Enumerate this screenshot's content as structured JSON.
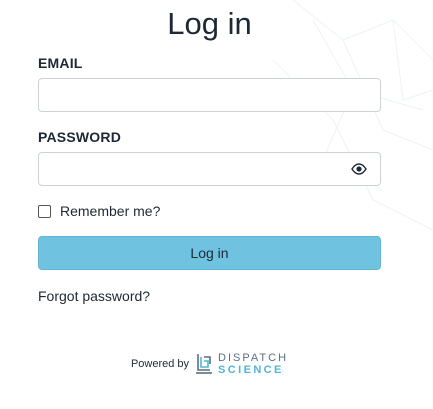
{
  "page": {
    "title": "Log in"
  },
  "form": {
    "email_label": "EMAIL",
    "email_value": "",
    "password_label": "PASSWORD",
    "password_value": "",
    "remember_label": "Remember me?",
    "remember_checked": false,
    "submit_label": "Log in",
    "forgot_label": "Forgot password?"
  },
  "footer": {
    "powered_by": "Powered by",
    "brand_line1": "DISPATCH",
    "brand_line2": "SCIENCE"
  },
  "colors": {
    "button": "#6fc3e0",
    "brand_blue": "#4fb5d9",
    "brand_gray": "#5a6f80"
  },
  "icons": {
    "password_toggle": "eye-icon",
    "logo": "dispatch-science-logo-mark"
  }
}
